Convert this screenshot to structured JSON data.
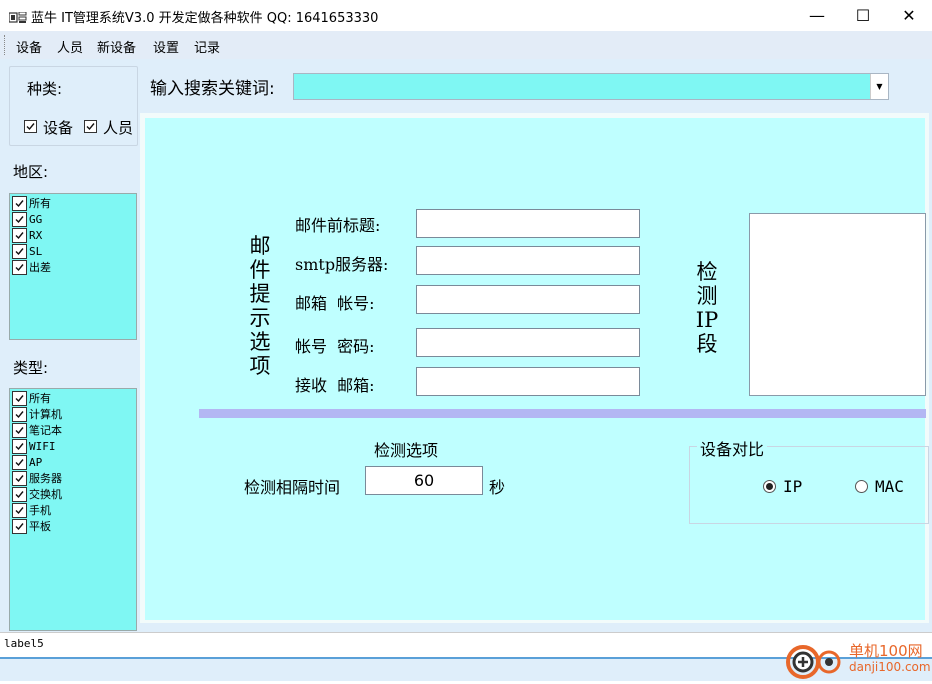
{
  "window": {
    "title": "蓝牛 IT管理系统V3.0  开发定做各种软件 QQ: 1641653330",
    "minimize": "—",
    "maximize": "☐",
    "close": "✕"
  },
  "menu": [
    "设备",
    "人员",
    "新设备",
    "设置",
    "记录"
  ],
  "sidebar": {
    "kind_label": "种类:",
    "kind_options": [
      {
        "label": "设备",
        "checked": true
      },
      {
        "label": "人员",
        "checked": true
      }
    ],
    "region_label": "地区:",
    "regions": [
      {
        "label": "所有",
        "checked": true
      },
      {
        "label": "GG",
        "checked": true
      },
      {
        "label": "RX",
        "checked": true
      },
      {
        "label": "SL",
        "checked": true
      },
      {
        "label": "出差",
        "checked": true
      }
    ],
    "type_label": "类型:",
    "types": [
      {
        "label": "所有",
        "checked": true
      },
      {
        "label": "计算机",
        "checked": true
      },
      {
        "label": "笔记本",
        "checked": true
      },
      {
        "label": "WIFI",
        "checked": true
      },
      {
        "label": "AP",
        "checked": true
      },
      {
        "label": "服务器",
        "checked": true
      },
      {
        "label": "交换机",
        "checked": true
      },
      {
        "label": "手机",
        "checked": true
      },
      {
        "label": "平板",
        "checked": true
      }
    ]
  },
  "search": {
    "label": "输入搜索关键词:",
    "value": ""
  },
  "settings": {
    "mail_section_label": "邮件提示选项",
    "fields": [
      {
        "label": "邮件前标题:",
        "value": ""
      },
      {
        "label": "smtp服务器:",
        "value": ""
      },
      {
        "label": "邮箱  帐号:",
        "value": ""
      },
      {
        "label": "帐号  密码:",
        "value": ""
      },
      {
        "label": "接收  邮箱:",
        "value": ""
      }
    ],
    "ip_section_label": "检测IP段",
    "detect_title": "检测选项",
    "interval_label": "检测相隔时间",
    "interval_value": "60",
    "interval_unit": "秒",
    "compare_title": "设备对比",
    "compare_options": [
      {
        "label": "IP",
        "selected": true
      },
      {
        "label": "MAC",
        "selected": false
      }
    ]
  },
  "status": {
    "text": "label5"
  },
  "watermark": {
    "line1": "单机100网",
    "line2": "danji100.com"
  },
  "colors": {
    "accent_cyan": "#7ff7f3",
    "panel_cyan": "#bfffff",
    "separator": "#b3b7f3",
    "watermark": "#e8672a"
  }
}
